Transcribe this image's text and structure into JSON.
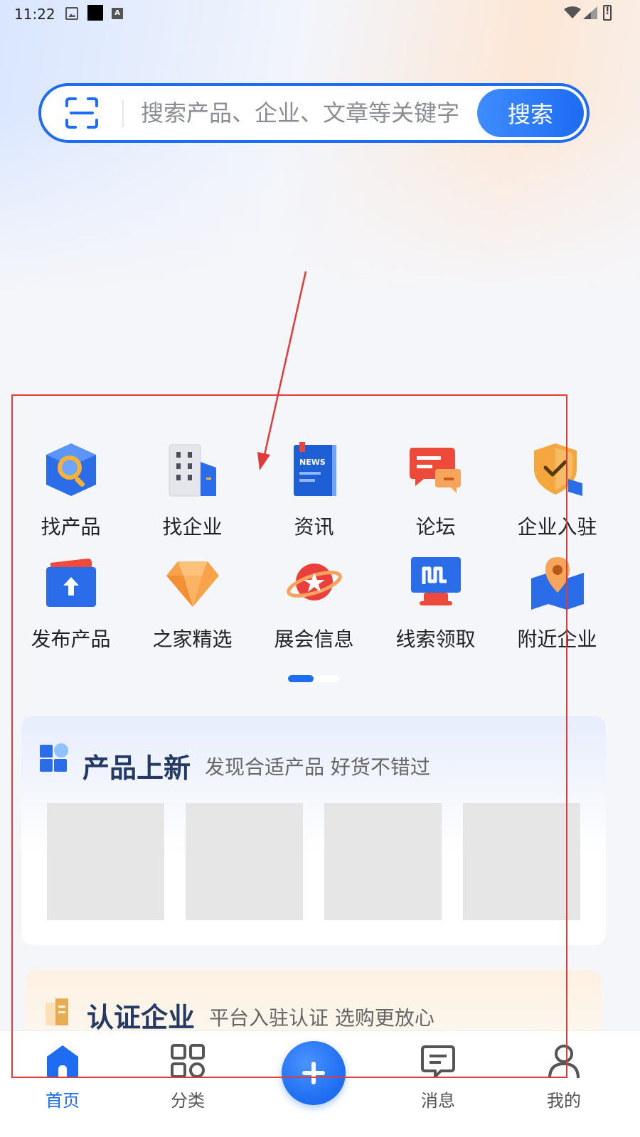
{
  "status_bar": {
    "time": "11:22"
  },
  "search": {
    "placeholder": "搜索产品、企业、文章等关键字",
    "button_label": "搜索"
  },
  "grid_items": [
    {
      "label": "找产品",
      "icon": "product-search-icon"
    },
    {
      "label": "找企业",
      "icon": "building-icon"
    },
    {
      "label": "资讯",
      "icon": "news-icon"
    },
    {
      "label": "论坛",
      "icon": "forum-chat-icon"
    },
    {
      "label": "企业入驻",
      "icon": "shield-check-icon"
    },
    {
      "label": "发布产品",
      "icon": "upload-folder-icon"
    },
    {
      "label": "之家精选",
      "icon": "diamond-icon"
    },
    {
      "label": "展会信息",
      "icon": "planet-star-icon"
    },
    {
      "label": "线索领取",
      "icon": "computer-lead-icon"
    },
    {
      "label": "附近企业",
      "icon": "location-map-icon"
    }
  ],
  "pager": {
    "pages": 2,
    "current": 1
  },
  "new_products": {
    "title": "产品上新",
    "subtitle": "发现合适产品 好货不错过"
  },
  "certified": {
    "title": "认证企业",
    "subtitle": "平台入驻认证 选购更放心"
  },
  "bottom_nav": {
    "home": "首页",
    "category": "分类",
    "messages": "消息",
    "mine": "我的"
  },
  "colors": {
    "accent": "#1d6cf2",
    "annotation": "#e03b3b"
  }
}
